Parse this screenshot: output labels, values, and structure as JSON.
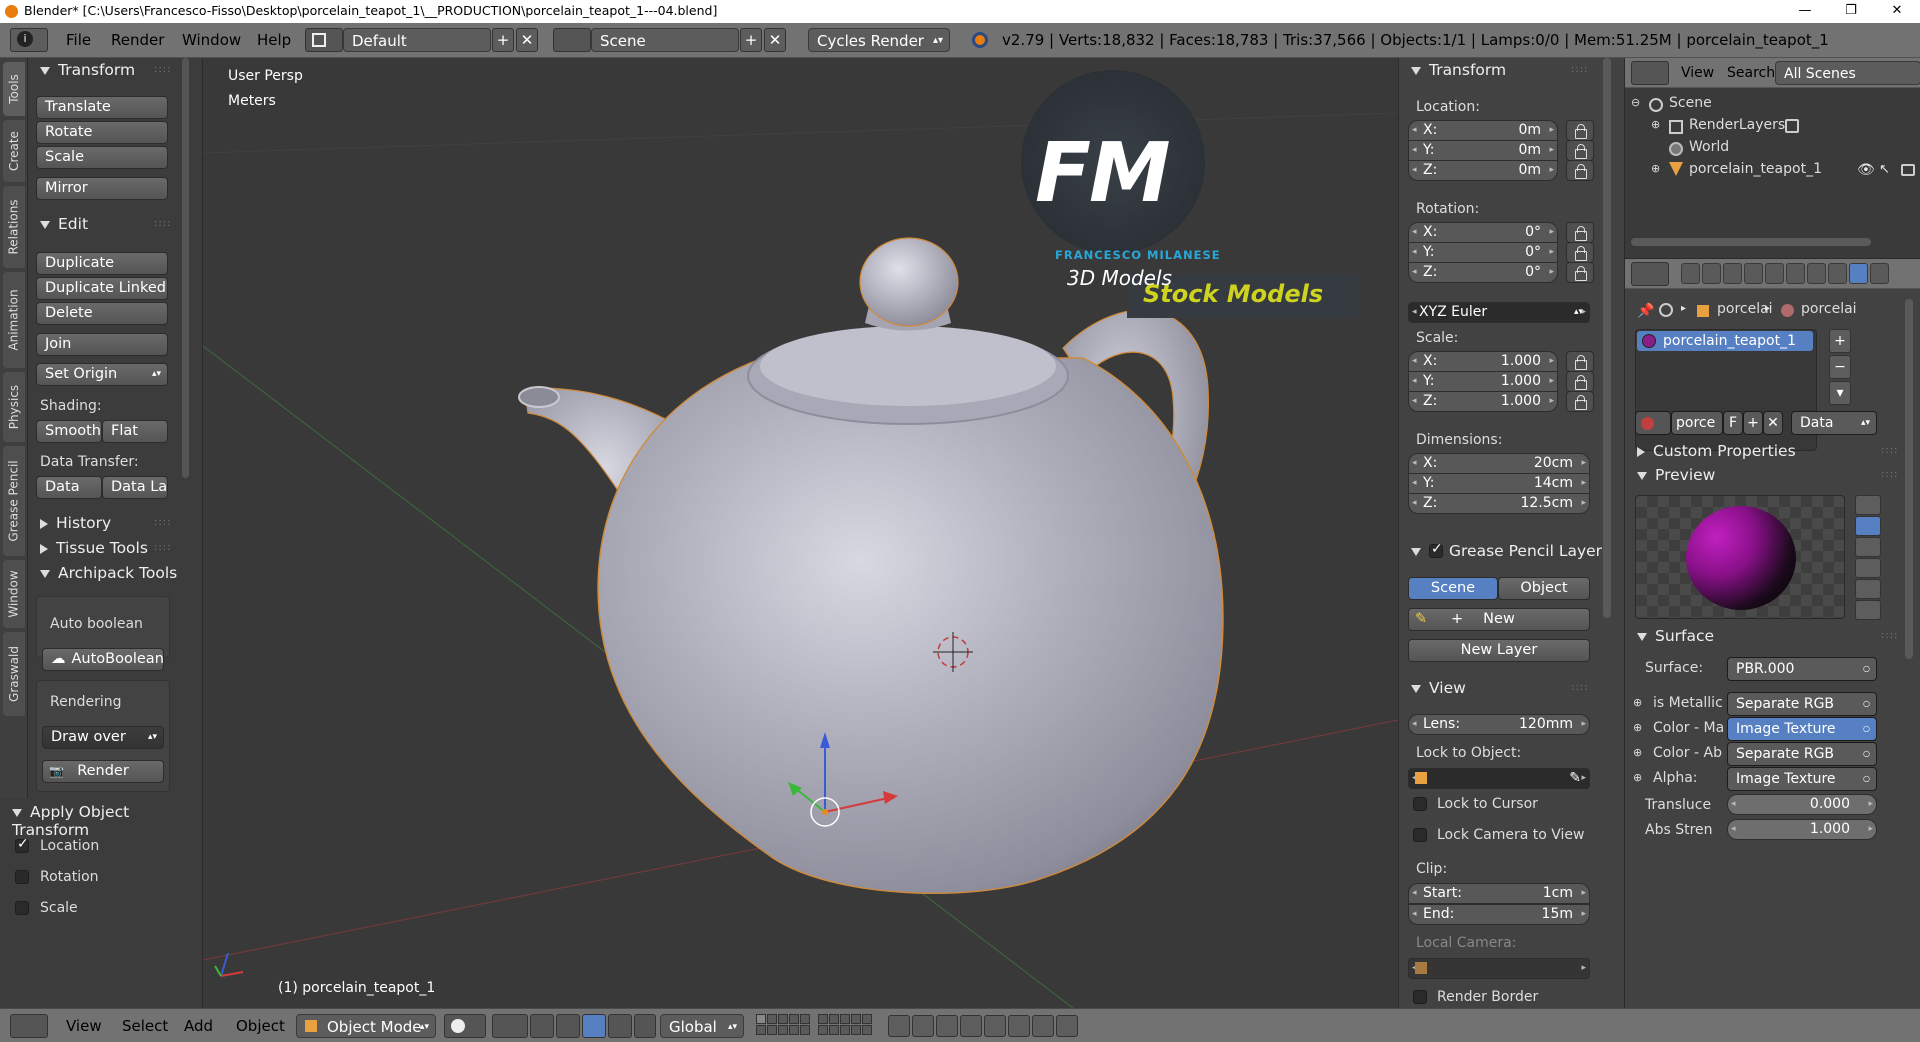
{
  "window": {
    "title": "Blender* [C:\\Users\\Francesco-Fisso\\Desktop\\porcelain_teapot_1\\__PRODUCTION\\porcelain_teapot_1---04.blend]"
  },
  "topbar": {
    "menus": [
      "File",
      "Render",
      "Window",
      "Help"
    ],
    "layout": "Default",
    "scene": "Scene",
    "engine": "Cycles Render",
    "stats": "v2.79 | Verts:18,832 | Faces:18,783 | Tris:37,566 | Objects:1/1 | Lamps:0/0 | Mem:51.25M | porcelain_teapot_1"
  },
  "left_tabs": [
    "Tools",
    "Create",
    "Relations",
    "Animation",
    "Physics",
    "Grease Pencil",
    "Window",
    "Graswald"
  ],
  "tool_shelf": {
    "transform_header": "Transform",
    "translate": "Translate",
    "rotate": "Rotate",
    "scale": "Scale",
    "mirror": "Mirror",
    "edit_header": "Edit",
    "duplicate": "Duplicate",
    "duplicate_linked": "Duplicate Linked",
    "delete": "Delete",
    "join": "Join",
    "set_origin": "Set Origin",
    "shading_label": "Shading:",
    "smooth": "Smooth",
    "flat": "Flat",
    "data_transfer_label": "Data Transfer:",
    "data": "Data",
    "data_la": "Data La",
    "history": "History",
    "tissue_tools": "Tissue Tools",
    "archipack_tools": "Archipack Tools",
    "auto_boolean_label": "Auto boolean",
    "auto_boolean_btn": "AutoBoolean",
    "rendering_label": "Rendering",
    "draw_over": "Draw over",
    "render": "Render"
  },
  "apply_panel": {
    "header": "Apply Object Transform",
    "location": "Location",
    "rotation": "Rotation",
    "scale": "Scale"
  },
  "viewport": {
    "view_name": "User Persp",
    "units": "Meters",
    "object_label": "(1) porcelain_teapot_1",
    "logo_fm": "FM",
    "logo_name": "FRANCESCO MILANESE",
    "logo_3d": "3D Models",
    "logo_stock": "Stock Models"
  },
  "n_panel": {
    "transform_header": "Transform",
    "location_label": "Location:",
    "location": [
      {
        "k": "X:",
        "v": "0m"
      },
      {
        "k": "Y:",
        "v": "0m"
      },
      {
        "k": "Z:",
        "v": "0m"
      }
    ],
    "rotation_label": "Rotation:",
    "rotation": [
      {
        "k": "X:",
        "v": "0°"
      },
      {
        "k": "Y:",
        "v": "0°"
      },
      {
        "k": "Z:",
        "v": "0°"
      }
    ],
    "rotation_mode": "XYZ Euler",
    "scale_label": "Scale:",
    "scale": [
      {
        "k": "X:",
        "v": "1.000"
      },
      {
        "k": "Y:",
        "v": "1.000"
      },
      {
        "k": "Z:",
        "v": "1.000"
      }
    ],
    "dimensions_label": "Dimensions:",
    "dimensions": [
      {
        "k": "X:",
        "v": "20cm"
      },
      {
        "k": "Y:",
        "v": "14cm"
      },
      {
        "k": "Z:",
        "v": "12.5cm"
      }
    ],
    "grease_header": "Grease Pencil Layer",
    "gp_scene": "Scene",
    "gp_object": "Object",
    "gp_new": "New",
    "gp_new_layer": "New Layer",
    "view_header": "View",
    "lens_k": "Lens:",
    "lens_v": "120mm",
    "lock_to_object": "Lock to Object:",
    "lock_to_cursor": "Lock to Cursor",
    "lock_camera": "Lock Camera to View",
    "clip_label": "Clip:",
    "clip_start_k": "Start:",
    "clip_start_v": "1cm",
    "clip_end_k": "End:",
    "clip_end_v": "15m",
    "local_camera": "Local Camera:",
    "render_border": "Render Border"
  },
  "outliner": {
    "view": "View",
    "search": "Search",
    "all_scenes": "All Scenes",
    "scene": "Scene",
    "render_layers": "RenderLayers",
    "world": "World",
    "object": "porcelain_teapot_1"
  },
  "properties": {
    "crumb1": "porcelai",
    "crumb2": "porcelai",
    "material_slot": "porcelain_teapot_1",
    "mat_name": "porce",
    "mat_f": "F",
    "data_select": "Data",
    "custom_props": "Custom Properties",
    "preview": "Preview",
    "surface_header": "Surface",
    "surface_label": "Surface:",
    "surface_value": "PBR.000",
    "inputs": [
      {
        "k": "is Metallic",
        "v": "Separate RGB"
      },
      {
        "k": "Color - Ma",
        "v": "Image Texture"
      },
      {
        "k": "Color - Ab",
        "v": "Separate RGB"
      },
      {
        "k": "Alpha:",
        "v": "Image Texture"
      }
    ],
    "translucence_k": "Transluce",
    "translucence_v": "0.000",
    "abs_k": "Abs Stren",
    "abs_v": "1.000"
  },
  "bottombar": {
    "view": "View",
    "select": "Select",
    "add": "Add",
    "object": "Object",
    "mode": "Object Mode",
    "orientation": "Global"
  }
}
